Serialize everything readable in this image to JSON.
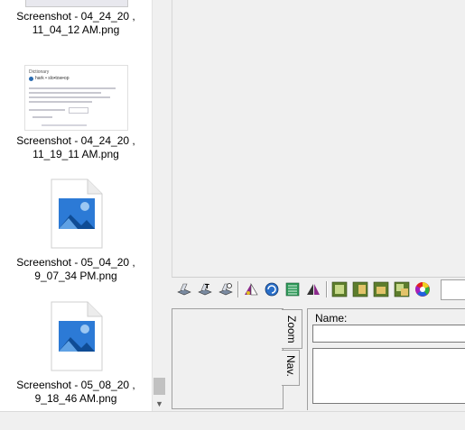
{
  "files": [
    {
      "name_line1": "Screenshot - 04_24_20 ,",
      "name_line2": "11_04_12 AM.png",
      "thumb": "screenshot-thumbnail"
    },
    {
      "name_line1": "Screenshot - 04_24_20 ,",
      "name_line2": "11_19_11 AM.png",
      "thumb": "dictionary-screenshot-thumbnail",
      "thumb_heading": "Dictionary",
      "thumb_word": "hark • slo•tow•op"
    },
    {
      "name_line1": "Screenshot - 05_04_20 ,",
      "name_line2": "9_07_34 PM.png",
      "thumb": "image-file-icon"
    },
    {
      "name_line1": "Screenshot - 05_08_20 ,",
      "name_line2": "9_18_46 AM.png",
      "thumb": "image-file-icon"
    }
  ],
  "tabs": {
    "zoom_label": "Zoom",
    "nav_label": "Nav."
  },
  "name_panel": {
    "label": "Name:",
    "value": ""
  },
  "icons": {
    "toolbar": [
      "scan-icon",
      "scan-text-icon",
      "scan-options-icon",
      "sharpen-icon",
      "rotate-icon",
      "list-icon",
      "flip-icon",
      "image-add-icon",
      "image-move-icon",
      "image-copy-icon",
      "image-paste-icon",
      "color-wheel-icon"
    ]
  },
  "colors": {
    "image_icon_blue": "#1b5fa8",
    "image_icon_light": "#7aaee0",
    "doc_gray": "#e8e8ee"
  }
}
